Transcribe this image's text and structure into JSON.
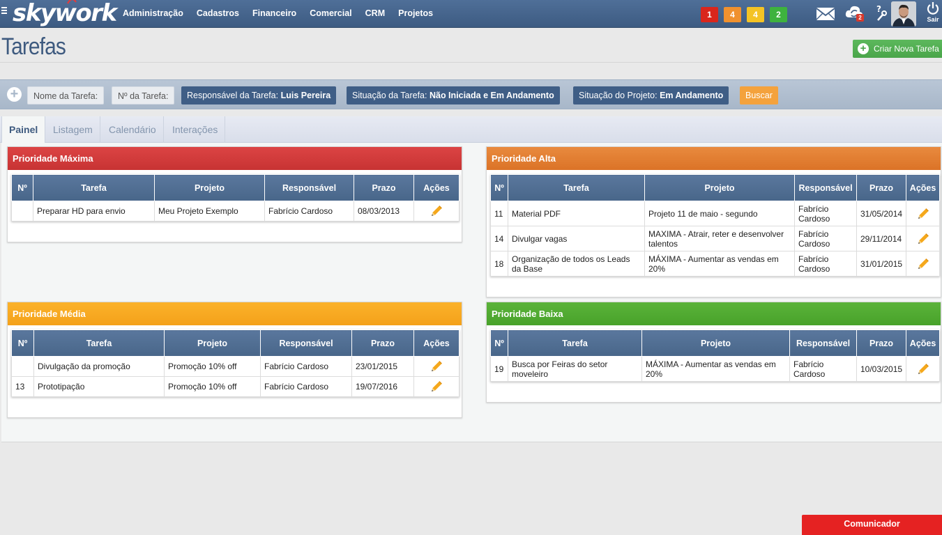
{
  "app": {
    "logo": "skywork"
  },
  "nav": [
    "Administração",
    "Cadastros",
    "Financeiro",
    "Comercial",
    "CRM",
    "Projetos"
  ],
  "badges": [
    {
      "count": "1",
      "color": "#d9261c"
    },
    {
      "count": "4",
      "color": "#f0912e"
    },
    {
      "count": "4",
      "color": "#f4c324"
    },
    {
      "count": "2",
      "color": "#3eb23e"
    }
  ],
  "header_icons": {
    "cloud_badge": "2",
    "logout_label": "Sair"
  },
  "page": {
    "title": "Tarefas",
    "create_button": "Criar Nova Tarefa"
  },
  "filters": {
    "name_task": "Nome da Tarefa:",
    "number_task": "Nº da Tarefa:",
    "responsavel_label": "Responsável da Tarefa:",
    "responsavel_value": "Luis Pereira",
    "situacao_tarefa_label": "Situação da Tarefa:",
    "situacao_tarefa_value": "Não Iniciada e Em Andamento",
    "situacao_projeto_label": "Situação do Projeto:",
    "situacao_projeto_value": "Em Andamento",
    "search_button": "Buscar"
  },
  "tabs": [
    "Painel",
    "Listagem",
    "Calendário",
    "Interações"
  ],
  "columns": {
    "num": "Nº",
    "task": "Tarefa",
    "project": "Projeto",
    "owner": "Responsável",
    "due": "Prazo",
    "actions": "Ações"
  },
  "panels": {
    "maxima": {
      "title": "Prioridade Máxima",
      "rows": [
        {
          "num": "",
          "task": "Preparar HD para envio",
          "project": "Meu Projeto Exemplo",
          "owner": "Fabrício Cardoso",
          "due": "08/03/2013"
        }
      ]
    },
    "alta": {
      "title": "Prioridade Alta",
      "rows": [
        {
          "num": "11",
          "task": "Material PDF",
          "project": "Projeto 11 de maio - segundo",
          "owner": "Fabrício Cardoso",
          "due": "31/05/2014"
        },
        {
          "num": "14",
          "task": "Divulgar vagas",
          "project": "MAXIMA - Atrair, reter e desenvolver talentos",
          "owner": "Fabrício Cardoso",
          "due": "29/11/2014"
        },
        {
          "num": "18",
          "task": "Organização de todos os Leads da Base",
          "project": "MÁXIMA - Aumentar as vendas em 20%",
          "owner": "Fabrício Cardoso",
          "due": "31/01/2015"
        }
      ]
    },
    "media": {
      "title": "Prioridade Média",
      "rows": [
        {
          "num": "",
          "task": "Divulgação da promoção",
          "project": "Promoção 10% off",
          "owner": "Fabrício Cardoso",
          "due": "23/01/2015"
        },
        {
          "num": "13",
          "task": "Prototipação",
          "project": "Promoção 10% off",
          "owner": "Fabrício Cardoso",
          "due": "19/07/2016"
        }
      ]
    },
    "baixa": {
      "title": "Prioridade Baixa",
      "rows": [
        {
          "num": "19",
          "task": "Busca por Feiras do setor moveleiro",
          "project": "MÁXIMA - Aumentar as vendas em 20%",
          "owner": "Fabrício Cardoso",
          "due": "10/03/2015"
        }
      ]
    }
  },
  "footer": {
    "comunicador": "Comunicador"
  }
}
